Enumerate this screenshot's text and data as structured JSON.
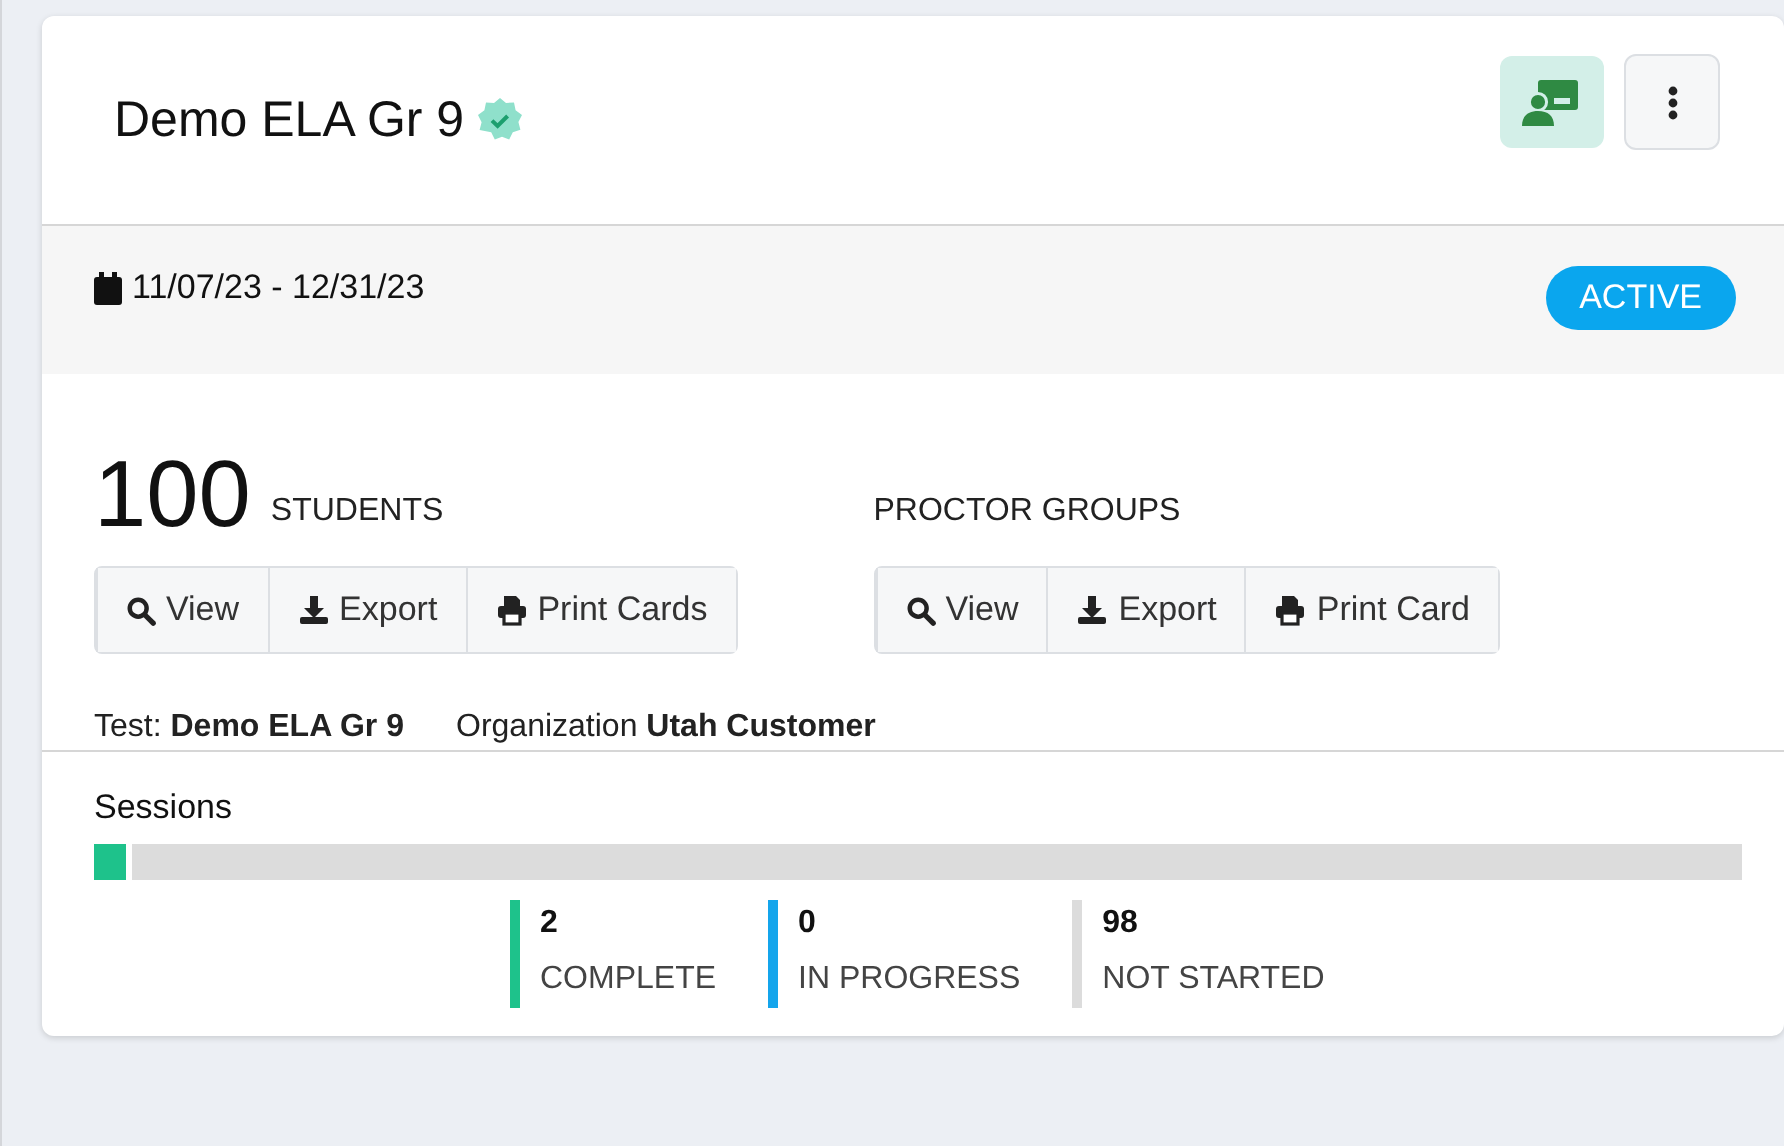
{
  "title": "Demo ELA Gr 9",
  "verified": true,
  "date_range": "11/07/23 - 12/31/23",
  "status": "ACTIVE",
  "students": {
    "count": "100",
    "label": "STUDENTS",
    "buttons": [
      {
        "kind": "view",
        "label": "View"
      },
      {
        "kind": "export",
        "label": "Export"
      },
      {
        "kind": "print",
        "label": "Print Cards"
      }
    ]
  },
  "proctor_groups": {
    "label": "PROCTOR GROUPS",
    "buttons": [
      {
        "kind": "view",
        "label": "View"
      },
      {
        "kind": "export",
        "label": "Export"
      },
      {
        "kind": "print",
        "label": "Print Card"
      }
    ]
  },
  "details": [
    {
      "label": "Test:",
      "value": "Demo ELA Gr 9"
    },
    {
      "label": "Organization",
      "value": "Utah Customer"
    }
  ],
  "sessions": {
    "title": "Sessions",
    "statuses": [
      {
        "count": "2",
        "label": "COMPLETE",
        "color": "#1ec28b"
      },
      {
        "count": "0",
        "label": "IN PROGRESS",
        "color": "#14a5ec"
      },
      {
        "count": "98",
        "label": "NOT STARTED",
        "color": "#dcdcdc"
      }
    ]
  }
}
